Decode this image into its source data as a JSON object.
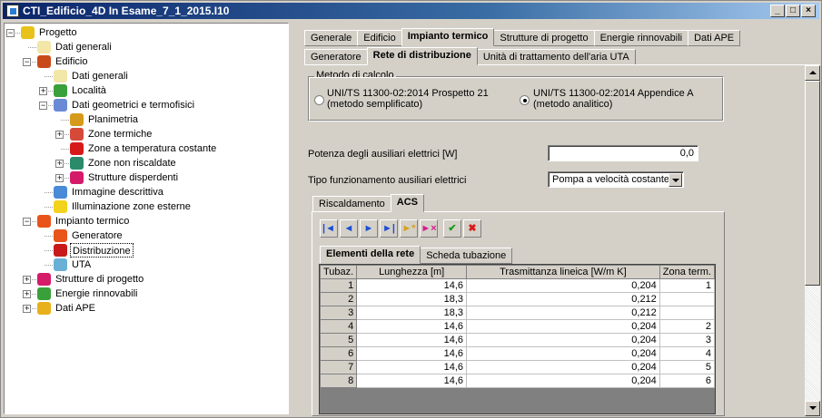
{
  "window": {
    "title": "CTI_Edificio_4D In Esame_7_1_2015.I10",
    "min": "_",
    "max": "□",
    "close": "×"
  },
  "tree": [
    {
      "label": "Progetto",
      "icon": "gear-icon"
    },
    {
      "label": "Dati generali",
      "icon": "document-icon"
    },
    {
      "label": "Edificio",
      "icon": "building-icon"
    },
    {
      "label": "Dati generali",
      "icon": "document-icon"
    },
    {
      "label": "Località",
      "icon": "location-icon"
    },
    {
      "label": "Dati geometrici e termofisici",
      "icon": "geometry-icon"
    },
    {
      "label": "Planimetria",
      "icon": "planimetry-icon"
    },
    {
      "label": "Zone termiche",
      "icon": "thermal-zone-icon"
    },
    {
      "label": "Zone a temperatura costante",
      "icon": "thermometer-icon"
    },
    {
      "label": "Zone non riscaldate",
      "icon": "snowflake-icon"
    },
    {
      "label": "Strutture disperdenti",
      "icon": "structure-icon"
    },
    {
      "label": "Immagine descrittiva",
      "icon": "image-icon"
    },
    {
      "label": "Illuminazione zone esterne",
      "icon": "bulb-icon"
    },
    {
      "label": "Impianto termico",
      "icon": "flame-icon"
    },
    {
      "label": "Generatore",
      "icon": "flame-icon"
    },
    {
      "label": "Distribuzione",
      "icon": "pipe-icon"
    },
    {
      "label": "UTA",
      "icon": "fan-icon"
    },
    {
      "label": "Strutture di progetto",
      "icon": "structure-icon"
    },
    {
      "label": "Energie rinnovabili",
      "icon": "renewable-icon"
    },
    {
      "label": "Dati APE",
      "icon": "ape-icon"
    }
  ],
  "tabs_main": [
    "Generale",
    "Edificio",
    "Impianto termico",
    "Strutture di progetto",
    "Energie rinnovabili",
    "Dati APE"
  ],
  "tabs_sub": [
    "Generatore",
    "Rete di distribuzione",
    "Unità di trattamento dell'aria UTA"
  ],
  "metodo": {
    "group_label": "Metodo di calcolo",
    "opt1_line1": "UNI/TS 11300-02:2014 Prospetto 21",
    "opt1_line2": "(metodo semplificato)",
    "opt2_line1": "UNI/TS 11300-02:2014 Appendice A",
    "opt2_line2": "(metodo analitico)",
    "selected": 2
  },
  "potenza": {
    "label": "Potenza degli ausiliari elettrici [W]",
    "value": "0,0"
  },
  "tipo": {
    "label": "Tipo funzionamento ausiliari elettrici",
    "value": "Pompa a velocità costante"
  },
  "tabs_service": [
    "Riscaldamento",
    "ACS"
  ],
  "nav_buttons": [
    {
      "name": "first-record-icon",
      "glyph": "|◄",
      "color": "#1a4fd6"
    },
    {
      "name": "prev-record-icon",
      "glyph": "◄",
      "color": "#1a4fd6"
    },
    {
      "name": "next-record-icon",
      "glyph": "►",
      "color": "#1a4fd6"
    },
    {
      "name": "last-record-icon",
      "glyph": "►|",
      "color": "#1a4fd6"
    },
    {
      "name": "insert-record-icon",
      "glyph": "►*",
      "color": "#d6a21a"
    },
    {
      "name": "delete-record-icon",
      "glyph": "►×",
      "color": "#d61a8f"
    },
    {
      "name": "confirm-icon",
      "glyph": "✔",
      "color": "#1a9a1a"
    },
    {
      "name": "cancel-icon",
      "glyph": "✖",
      "color": "#d61a1a"
    }
  ],
  "tabs_grid": [
    "Elementi della rete",
    "Scheda tubazione"
  ],
  "table": {
    "headers": [
      "Tubaz.",
      "Lunghezza [m]",
      "Trasmittanza lineica [W/m K]",
      "Zona term."
    ],
    "rows": [
      [
        "1",
        "14,6",
        "0,204",
        "1"
      ],
      [
        "2",
        "18,3",
        "0,212",
        ""
      ],
      [
        "3",
        "18,3",
        "0,212",
        ""
      ],
      [
        "4",
        "14,6",
        "0,204",
        "2"
      ],
      [
        "5",
        "14,6",
        "0,204",
        "3"
      ],
      [
        "6",
        "14,6",
        "0,204",
        "4"
      ],
      [
        "7",
        "14,6",
        "0,204",
        "5"
      ],
      [
        "8",
        "14,6",
        "0,204",
        "6"
      ]
    ]
  }
}
